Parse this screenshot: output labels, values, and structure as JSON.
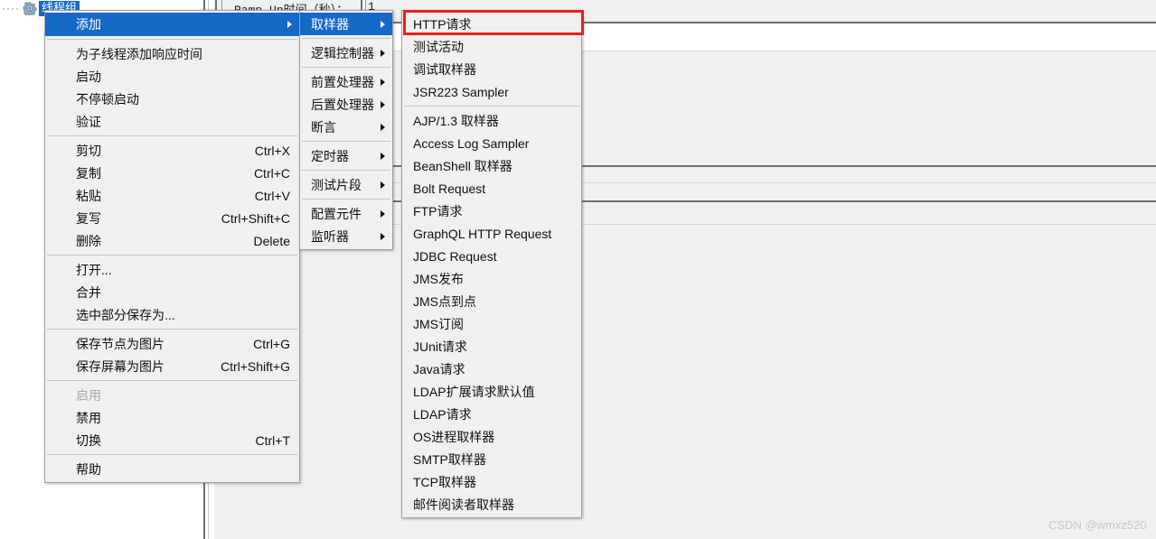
{
  "app": {
    "tree": {
      "selected_node": "线程组",
      "node_icon": "gear-icon"
    },
    "form": {
      "ramp_up_label": "Ramp-Up时间（秒）：",
      "ramp_up_value": "1"
    },
    "watermark": "CSDN @wmxz520"
  },
  "context_menu": {
    "name": "tree-node-context-menu",
    "items": [
      {
        "label": "添加",
        "accel": "",
        "submenu": true,
        "selected": true
      },
      {
        "separator": true
      },
      {
        "label": "为子线程添加响应时间",
        "accel": "",
        "submenu": false
      },
      {
        "label": "启动",
        "accel": "",
        "submenu": false
      },
      {
        "label": "不停顿启动",
        "accel": "",
        "submenu": false
      },
      {
        "label": "验证",
        "accel": "",
        "submenu": false
      },
      {
        "separator": true
      },
      {
        "label": "剪切",
        "accel": "Ctrl+X",
        "submenu": false
      },
      {
        "label": "复制",
        "accel": "Ctrl+C",
        "submenu": false
      },
      {
        "label": "粘贴",
        "accel": "Ctrl+V",
        "submenu": false
      },
      {
        "label": "复写",
        "accel": "Ctrl+Shift+C",
        "submenu": false
      },
      {
        "label": "删除",
        "accel": "Delete",
        "submenu": false
      },
      {
        "separator": true
      },
      {
        "label": "打开...",
        "accel": "",
        "submenu": false
      },
      {
        "label": "合并",
        "accel": "",
        "submenu": false
      },
      {
        "label": "选中部分保存为...",
        "accel": "",
        "submenu": false
      },
      {
        "separator": true
      },
      {
        "label": "保存节点为图片",
        "accel": "Ctrl+G",
        "submenu": false
      },
      {
        "label": "保存屏幕为图片",
        "accel": "Ctrl+Shift+G",
        "submenu": false
      },
      {
        "separator": true
      },
      {
        "label": "启用",
        "accel": "",
        "submenu": false,
        "disabled": true
      },
      {
        "label": "禁用",
        "accel": "",
        "submenu": false
      },
      {
        "label": "切换",
        "accel": "Ctrl+T",
        "submenu": false
      },
      {
        "separator": true
      },
      {
        "label": "帮助",
        "accel": "",
        "submenu": false
      }
    ]
  },
  "add_submenu": {
    "name": "add-submenu",
    "items": [
      {
        "label": "取样器",
        "submenu": true,
        "selected": true
      },
      {
        "separator": true
      },
      {
        "label": "逻辑控制器",
        "submenu": true
      },
      {
        "separator": true
      },
      {
        "label": "前置处理器",
        "submenu": true
      },
      {
        "label": "后置处理器",
        "submenu": true
      },
      {
        "label": "断言",
        "submenu": true
      },
      {
        "separator": true
      },
      {
        "label": "定时器",
        "submenu": true
      },
      {
        "separator": true
      },
      {
        "label": "测试片段",
        "submenu": true
      },
      {
        "separator": true
      },
      {
        "label": "配置元件",
        "submenu": true
      },
      {
        "label": "监听器",
        "submenu": true
      }
    ]
  },
  "sampler_submenu": {
    "name": "sampler-submenu",
    "highlight_label": "HTTP请求",
    "highlight_color": "#ee1c1c",
    "items": [
      {
        "label": "HTTP请求",
        "highlighted": true
      },
      {
        "label": "测试活动"
      },
      {
        "label": "调试取样器"
      },
      {
        "label": "JSR223 Sampler"
      },
      {
        "separator": true
      },
      {
        "label": "AJP/1.3 取样器"
      },
      {
        "label": "Access Log Sampler"
      },
      {
        "label": "BeanShell 取样器"
      },
      {
        "label": "Bolt Request"
      },
      {
        "label": "FTP请求"
      },
      {
        "label": "GraphQL HTTP Request"
      },
      {
        "label": "JDBC Request"
      },
      {
        "label": "JMS发布"
      },
      {
        "label": "JMS点到点"
      },
      {
        "label": "JMS订阅"
      },
      {
        "label": "JUnit请求"
      },
      {
        "label": "Java请求"
      },
      {
        "label": "LDAP扩展请求默认值"
      },
      {
        "label": "LDAP请求"
      },
      {
        "label": "OS进程取样器"
      },
      {
        "label": "SMTP取样器"
      },
      {
        "label": "TCP取样器"
      },
      {
        "label": "邮件阅读者取样器"
      }
    ]
  }
}
